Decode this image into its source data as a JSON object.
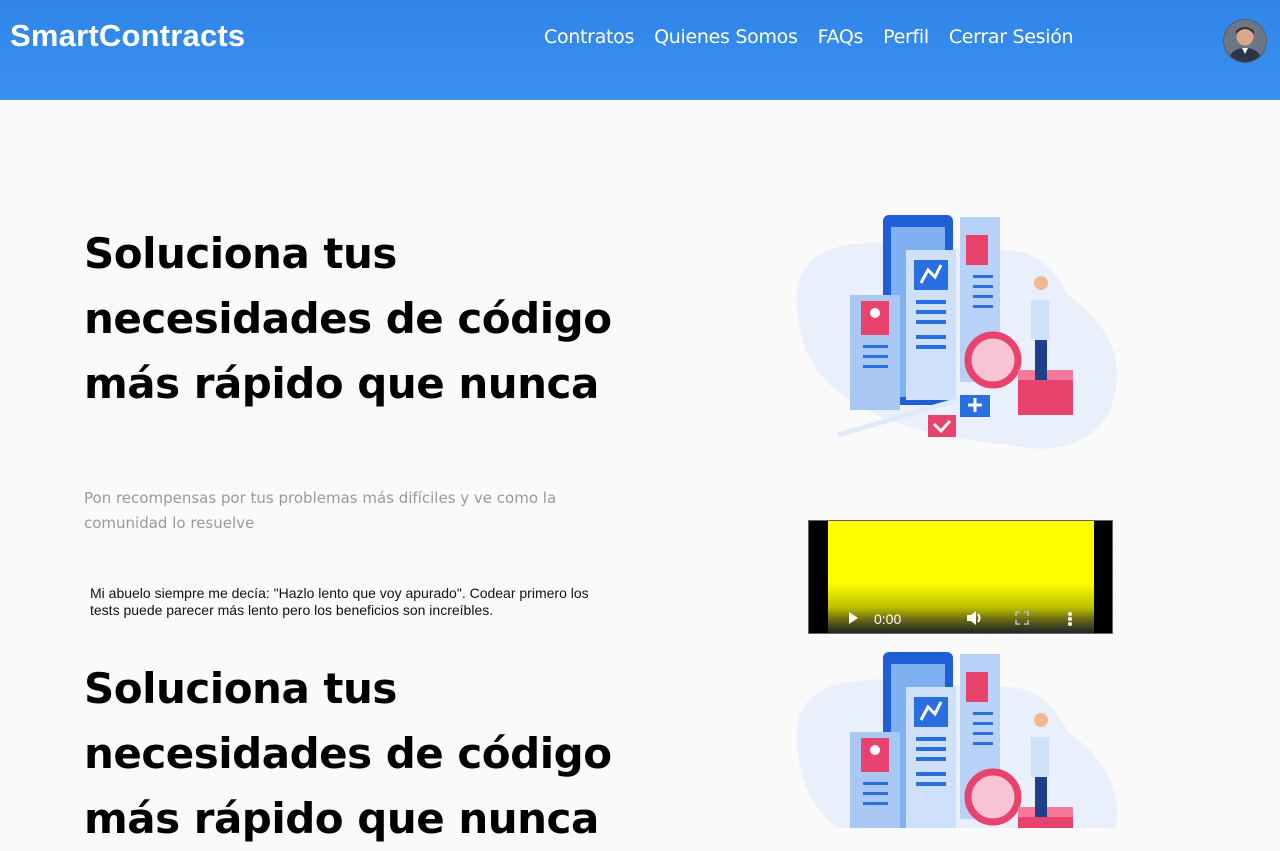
{
  "navbar": {
    "brand": "SmartContracts",
    "links": [
      "Contratos",
      "Quienes Somos",
      "FAQs",
      "Perfil",
      "Cerrar Sesión"
    ]
  },
  "hero": {
    "title": "Soluciona tus necesidades de código más rápido que nunca",
    "subtitle": "Pon recompensas por tus problemas más difíciles y ve como la comunidad lo resuelve",
    "quote": "Mi abuelo siempre me decía: \"Hazlo lento que voy apurado\". Codear primero los tests puede parecer más lento pero los beneficios son increíbles."
  },
  "hero2": {
    "title": "Soluciona tus necesidades de código más rápido que nunca"
  },
  "video": {
    "time": "0:00",
    "icons": [
      "play-icon",
      "volume-icon",
      "fullscreen-icon",
      "more-options-icon"
    ]
  },
  "colors": {
    "navbar": "#2f86e8",
    "video_frame": "#ffff00",
    "accent_pink": "#e8436d",
    "accent_blue": "#2a6fe0"
  }
}
